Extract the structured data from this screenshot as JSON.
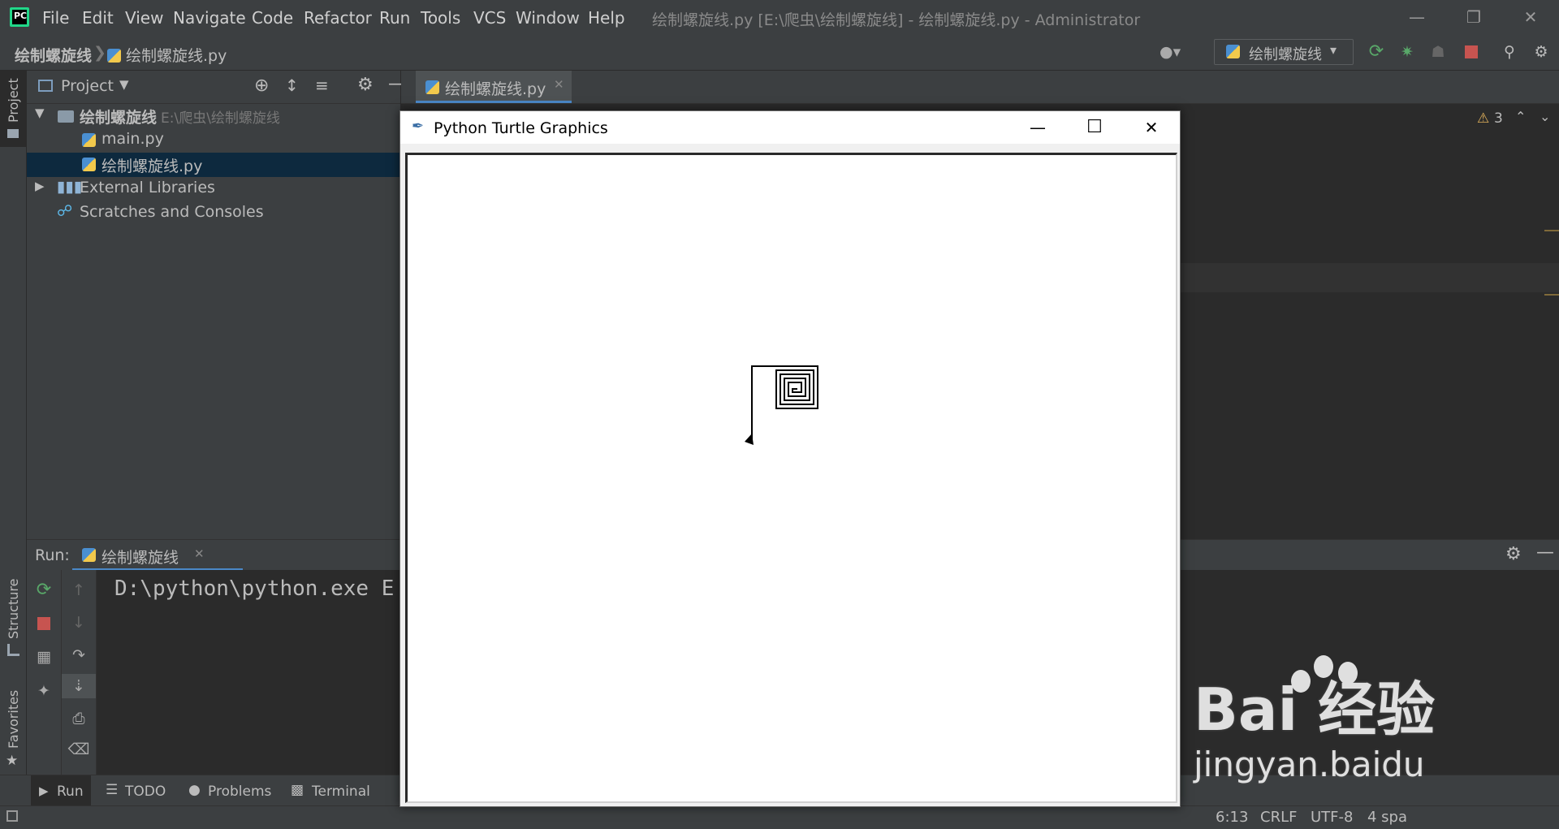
{
  "menu": [
    "File",
    "Edit",
    "View",
    "Navigate",
    "Code",
    "Refactor",
    "Run",
    "Tools",
    "VCS",
    "Window",
    "Help"
  ],
  "window_title": "绘制螺旋线.py [E:\\爬虫\\绘制螺旋线] - 绘制螺旋线.py - Administrator",
  "breadcrumb": {
    "project": "绘制螺旋线",
    "file": "绘制螺旋线.py"
  },
  "run_config": "绘制螺旋线",
  "project_panel": {
    "title": "Project",
    "root_name": "绘制螺旋线",
    "root_path": "E:\\爬虫\\绘制螺旋线",
    "files": [
      "main.py",
      "绘制螺旋线.py"
    ],
    "external": "External Libraries",
    "scratches": "Scratches and Consoles"
  },
  "editor_tab": "绘制螺旋线.py",
  "inspection_count": "3",
  "side_labels": {
    "project": "Project",
    "structure": "Structure",
    "favorites": "Favorites"
  },
  "run_panel": {
    "label": "Run:",
    "tab": "绘制螺旋线",
    "console_line": "D:\\python\\python.exe E"
  },
  "bottom_tabs": [
    "Run",
    "TODO",
    "Problems",
    "Terminal"
  ],
  "status": {
    "position": "6:13",
    "line_sep": "CRLF",
    "encoding": "UTF-8",
    "indent": "4 spa"
  },
  "turtle": {
    "title": "Python Turtle Graphics"
  },
  "watermark": {
    "brand": "Bai 经验",
    "url": "jingyan.baidu"
  }
}
